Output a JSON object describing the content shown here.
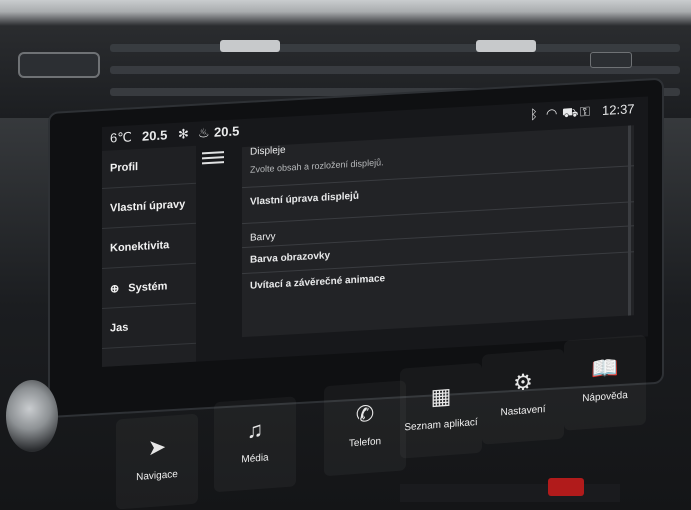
{
  "status_bar": {
    "outside_temp": "6℃",
    "temp_left": "20.5",
    "fan_icon": "fan-icon",
    "seat_heat_icon": "seat-heat-icon",
    "temp_right": "20.5",
    "bluetooth_icon": "bluetooth-icon",
    "wifi_icon": "wifi-icon",
    "car_icon": "car-icon",
    "key_icon": "key-icon",
    "clock": "12:37"
  },
  "sidebar": {
    "items": [
      {
        "label": "Profil"
      },
      {
        "label": "Vlastní úpravy"
      },
      {
        "label": "Konektivita"
      },
      {
        "label": "Systém",
        "icon": "globe-icon"
      },
      {
        "label": "Jas"
      }
    ]
  },
  "panel": {
    "title": "Displeje",
    "description": "Zvolte obsah a rozložení displejů.",
    "link": "Vlastní úprava displejů",
    "section": "Barvy",
    "color_item": "Barva obrazovky",
    "animation_item": "Uvítací a závěrečné animace"
  },
  "appbar": {
    "tiles": [
      {
        "label": "Navigace",
        "icon": "navigation-arrow-icon"
      },
      {
        "label": "Média",
        "icon": "music-note-icon"
      },
      {
        "label": "Telefon",
        "icon": "phone-icon"
      },
      {
        "label": "Seznam aplikací",
        "icon": "apps-grid-icon"
      },
      {
        "label": "Nastavení",
        "icon": "gear-icon"
      },
      {
        "label": "Nápověda",
        "icon": "book-icon"
      }
    ]
  },
  "colors": {
    "screen_bg": "#17181b",
    "text": "#e9eaeb",
    "hazard": "#b11b1b"
  }
}
